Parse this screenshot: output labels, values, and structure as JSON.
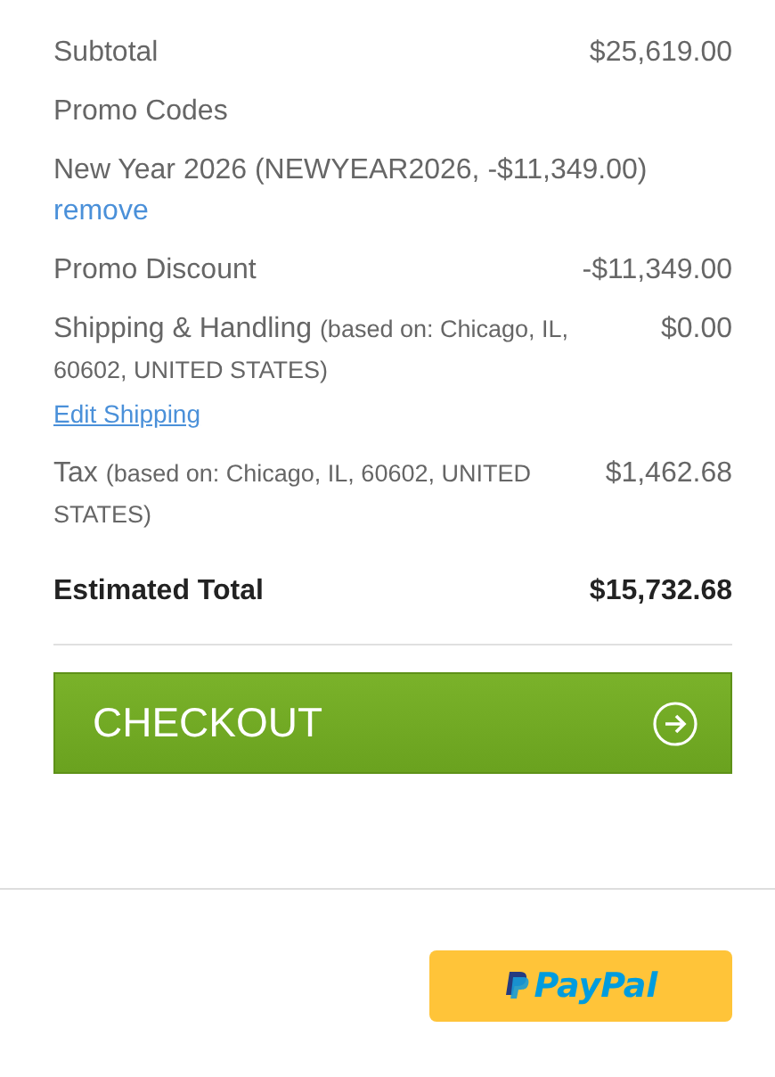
{
  "summary": [
    {
      "kind": "line",
      "label": "Subtotal",
      "value": "$25,619.00"
    },
    {
      "kind": "heading",
      "label": "Promo Codes"
    },
    {
      "kind": "promo",
      "label": "New Year 2026 (NEWYEAR2026, -$11,349.00)",
      "link": "remove"
    },
    {
      "kind": "line",
      "label": "Promo Discount",
      "value": "-$11,349.00"
    },
    {
      "kind": "line",
      "label": "Shipping & Handling",
      "note": "(based on: Chicago, IL, 60602, UNITED STATES)",
      "value": "$0.00",
      "link": "Edit Shipping"
    },
    {
      "kind": "line",
      "label": "Tax",
      "note": "(based on: Chicago, IL, 60602, UNITED STATES)",
      "value": "$1,462.68"
    },
    {
      "kind": "total",
      "label": "Estimated Total",
      "value": "$15,732.68"
    }
  ],
  "checkout_button": {
    "label": "CHECKOUT"
  },
  "paypal_button": {
    "label": "PayPal"
  }
}
